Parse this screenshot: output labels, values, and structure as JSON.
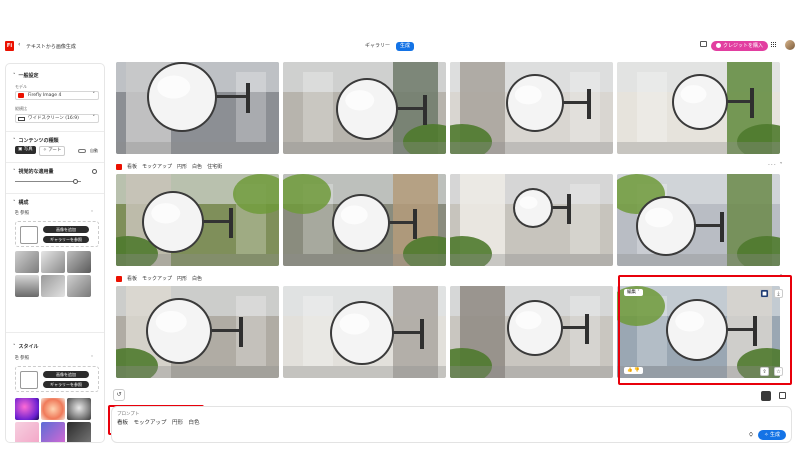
{
  "header": {
    "logo": "Fi",
    "back_icon": "‹",
    "title": "テキストから画像生成",
    "tabs": [
      "ギャラリー",
      "生成"
    ],
    "buy_credits": "クレジットを購入"
  },
  "sidebar": {
    "general": {
      "heading": "一般設定",
      "model_label": "モデル",
      "model_value": "Firefly Image 4",
      "ratio_label": "縦横比",
      "ratio_value": "ワイドスクリーン (16:9)"
    },
    "content_type": {
      "heading": "コンテンツの種類",
      "options": [
        "写真",
        "アート"
      ],
      "selected": "写真",
      "auto_label": "自動"
    },
    "visual_intensity": {
      "heading": "視覚的な適用量",
      "level": 0.92
    },
    "composition": {
      "heading": "構成",
      "reference_label": "参照",
      "upload_button": "画像を追加",
      "gallery_button": "ギャラリーを参照"
    },
    "style": {
      "heading": "スタイル",
      "reference_label": "参照",
      "upload_button": "画像を追加",
      "gallery_button": "ギャラリーを参照"
    }
  },
  "rows": [
    {
      "tags": []
    },
    {
      "tags": [
        "看板",
        "モックアップ",
        "円形",
        "白色",
        "住宅街"
      ]
    },
    {
      "tags": [
        "看板",
        "モックアップ",
        "円形",
        "白色"
      ]
    }
  ],
  "card_overlay": {
    "edit_label": "編集"
  },
  "prompt": {
    "label": "プロンプト",
    "text": "看板　モックアップ　円形　白色",
    "generate_button": "生成"
  },
  "colors": {
    "accent": "#1473e6",
    "brand": "#eb1000",
    "credits": "#e23ea0",
    "highlight": "#e8000b"
  }
}
